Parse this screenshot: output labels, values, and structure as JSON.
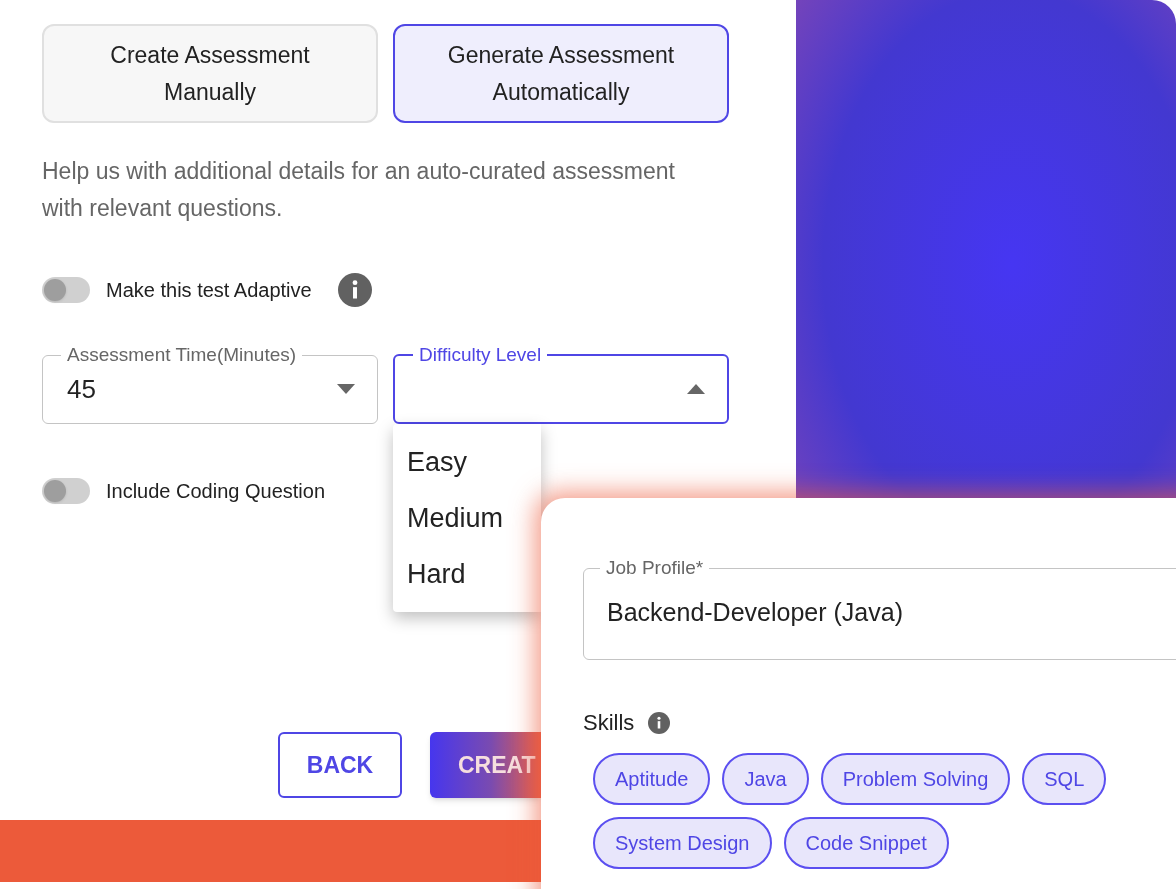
{
  "mode_options": [
    {
      "label": "Create Assessment Manually",
      "selected": false
    },
    {
      "label": "Generate Assessment Automatically",
      "selected": true
    }
  ],
  "description": "Help us with additional details for an auto-curated assessment with relevant questions.",
  "adaptive_toggle": {
    "label": "Make this test Adaptive",
    "on": false
  },
  "fields": [
    {
      "label": "Assessment Time(Minutes)",
      "value": "45",
      "focused": false
    },
    {
      "label": "Difficulty Level",
      "focused": true
    }
  ],
  "difficulty_menu": {
    "options": [
      "Easy",
      "Medium",
      "Hard"
    ]
  },
  "coding_toggle": {
    "label": "Include Coding Question",
    "on": false
  },
  "actions": [
    {
      "label": "BACK",
      "kind": "outlined"
    },
    {
      "label": "CREAT",
      "kind": "filled"
    }
  ],
  "job_profile_card": {
    "field": {
      "label": "Job Profile*",
      "value": "Backend-Developer (Java)"
    },
    "skills_label": "Skills",
    "skills": [
      "Aptitude",
      "Java",
      "Problem Solving",
      "SQL",
      "System Design",
      "Code Snippet"
    ]
  }
}
